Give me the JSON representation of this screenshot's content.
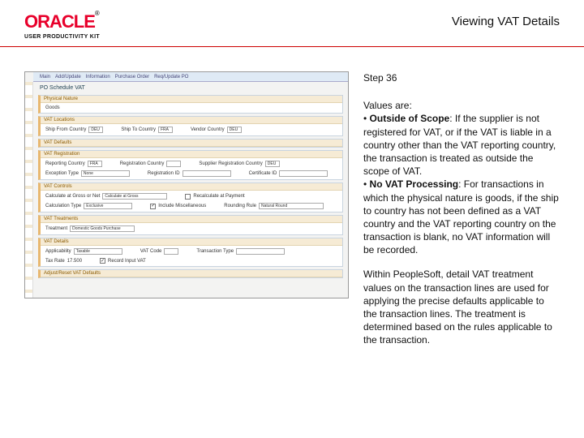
{
  "header": {
    "brand": "ORACLE",
    "upk": "USER PRODUCTIVITY KIT",
    "page_title": "Viewing VAT Details"
  },
  "step": "Step 36",
  "intro": "Values are:",
  "bullet1_label": "Outside of Scope",
  "bullet1_text": ": If the supplier is not registered for VAT, or if the VAT is liable in a country other than the VAT reporting country, the transaction is treated as outside the scope of VAT.",
  "bullet2_label": "No VAT Processing",
  "bullet2_text": ": For transactions in which the physical nature is goods, if the ship to country has not been defined as a VAT country and the VAT reporting country on the transaction is blank, no VAT information will be recorded.",
  "para2": "Within PeopleSoft, detail VAT treatment values on the transaction lines are used for applying the precise defaults applicable to the transaction lines. The treatment is determined based on the rules applicable to the transaction.",
  "shot": {
    "tabs": [
      "Main",
      "Add/Update",
      "Information",
      "Purchase Order",
      "Req/Update PO"
    ],
    "title": "PO Schedule VAT",
    "sections": {
      "phys": {
        "head": "Physical Nature",
        "value": "Goods"
      },
      "loc": {
        "head": "VAT Locations",
        "ship_from_label": "Ship From Country",
        "ship_from": "DEU",
        "ship_to_label": "Ship To Country",
        "ship_to": "FRA",
        "vendor_country_label": "Vendor Country",
        "vendor_country": "DEU"
      },
      "def": {
        "head": "VAT Defaults"
      },
      "reg": {
        "head": "VAT Registration",
        "reporting_label": "Reporting Country",
        "reporting": "FRA",
        "reg_country_label": "Registration Country",
        "reg_country": "",
        "supplier_reg_label": "Supplier Registration Country",
        "supplier_reg": "DEU",
        "exception_label": "Exception Type",
        "exception": "None",
        "reg_id_label": "Registration ID",
        "reg_id": "",
        "cert_label": "Certificate ID",
        "cert": ""
      },
      "ctrl": {
        "head": "VAT Controls",
        "calc_gross_label": "Calculate at Gross or Net",
        "calc_gross": "Calculate at Gross",
        "recalc_label": "Recalculate at Payment",
        "recalc": false,
        "calc_type_label": "Calculation Type",
        "calc_type": "Exclusive",
        "include_label": "Include Miscellaneous",
        "include": true,
        "rounding_label": "Rounding Rule",
        "rounding": "Natural Round"
      },
      "treat": {
        "head": "VAT Treatments",
        "treatment_label": "Treatment",
        "treatment": "Domestic Goods Purchase"
      },
      "details": {
        "head": "VAT Details",
        "applicability_label": "Applicability",
        "applicability": "Taxable",
        "vat_code_label": "VAT Code",
        "vat_code": "",
        "txn_type_label": "Transaction Type",
        "txn_type": "",
        "tax_rate_label": "Tax Rate",
        "tax_rate": "17.500",
        "record_input_label": "Record Input VAT",
        "record_input": true
      },
      "adjust": {
        "head": "Adjust/Reset VAT Defaults"
      }
    }
  }
}
